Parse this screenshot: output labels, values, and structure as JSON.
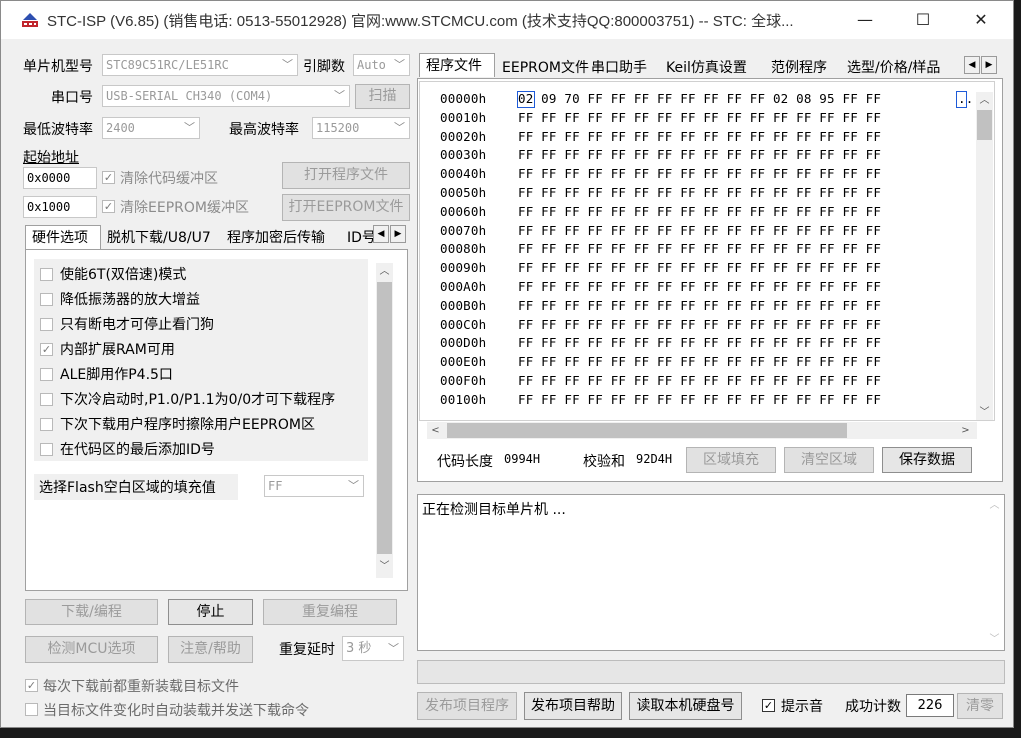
{
  "window": {
    "title": "STC-ISP (V6.85) (销售电话: 0513-55012928) 官网:www.STCMCU.com  (技术支持QQ:800003751)  -- STC: 全球...",
    "minimize": "—",
    "maximize": "☐",
    "close": "✕"
  },
  "left": {
    "mcu_type_label": "单片机型号",
    "mcu_type_value": "STC89C51RC/LE51RC",
    "pin_count_label": "引脚数",
    "pin_count_value": "Auto",
    "port_label": "串口号",
    "port_value": "USB-SERIAL CH340 (COM4)",
    "scan_button": "扫描",
    "min_baud_label": "最低波特率",
    "min_baud_value": "2400",
    "max_baud_label": "最高波特率",
    "max_baud_value": "115200",
    "start_addr_label": "起始地址",
    "code_addr": "0x0000",
    "clear_code_buffer": "清除代码缓冲区",
    "open_program_file": "打开程序文件",
    "eeprom_addr": "0x1000",
    "clear_eeprom_buffer": "清除EEPROM缓冲区",
    "open_eeprom_file": "打开EEPROM文件",
    "tabs": [
      "硬件选项",
      "脱机下载/U8/U7",
      "程序加密后传输",
      "ID号"
    ],
    "options": [
      {
        "label": "使能6T(双倍速)模式",
        "checked": false
      },
      {
        "label": "降低振荡器的放大增益",
        "checked": false
      },
      {
        "label": "只有断电才可停止看门狗",
        "checked": false
      },
      {
        "label": "内部扩展RAM可用",
        "checked": true
      },
      {
        "label": "ALE脚用作P4.5口",
        "checked": false
      },
      {
        "label": "下次冷启动时,P1.0/P1.1为0/0才可下载程序",
        "checked": false
      },
      {
        "label": "下次下载用户程序时擦除用户EEPROM区",
        "checked": false
      },
      {
        "label": "在代码区的最后添加ID号",
        "checked": false
      }
    ],
    "flash_fill_label": "选择Flash空白区域的填充值",
    "flash_fill_value": "FF",
    "download_button": "下载/编程",
    "stop_button": "停止",
    "reprogram_button": "重复编程",
    "detect_mcu_button": "检测MCU选项",
    "help_button": "注意/帮助",
    "repeat_delay_label": "重复延时",
    "repeat_delay_value": "3 秒",
    "reload_label": "每次下载前都重新装载目标文件",
    "reload_checked": true,
    "autoload_label": "当目标文件变化时自动装载并发送下载命令",
    "autoload_checked": false
  },
  "right": {
    "tabs": [
      "程序文件",
      "EEPROM文件",
      "串口助手",
      "Keil仿真设置",
      "范例程序",
      "选型/价格/样品"
    ],
    "hex": {
      "rows": [
        {
          "addr": "00000h",
          "bytes": "02 09 70 FF FF FF FF FF FF FF FF 02 08 95 FF FF",
          "ascii": ".."
        },
        {
          "addr": "00010h",
          "bytes": "FF FF FF FF FF FF FF FF FF FF FF FF FF FF FF FF"
        },
        {
          "addr": "00020h",
          "bytes": "FF FF FF FF FF FF FF FF FF FF FF FF FF FF FF FF"
        },
        {
          "addr": "00030h",
          "bytes": "FF FF FF FF FF FF FF FF FF FF FF FF FF FF FF FF"
        },
        {
          "addr": "00040h",
          "bytes": "FF FF FF FF FF FF FF FF FF FF FF FF FF FF FF FF"
        },
        {
          "addr": "00050h",
          "bytes": "FF FF FF FF FF FF FF FF FF FF FF FF FF FF FF FF"
        },
        {
          "addr": "00060h",
          "bytes": "FF FF FF FF FF FF FF FF FF FF FF FF FF FF FF FF"
        },
        {
          "addr": "00070h",
          "bytes": "FF FF FF FF FF FF FF FF FF FF FF FF FF FF FF FF"
        },
        {
          "addr": "00080h",
          "bytes": "FF FF FF FF FF FF FF FF FF FF FF FF FF FF FF FF"
        },
        {
          "addr": "00090h",
          "bytes": "FF FF FF FF FF FF FF FF FF FF FF FF FF FF FF FF"
        },
        {
          "addr": "000A0h",
          "bytes": "FF FF FF FF FF FF FF FF FF FF FF FF FF FF FF FF"
        },
        {
          "addr": "000B0h",
          "bytes": "FF FF FF FF FF FF FF FF FF FF FF FF FF FF FF FF"
        },
        {
          "addr": "000C0h",
          "bytes": "FF FF FF FF FF FF FF FF FF FF FF FF FF FF FF FF"
        },
        {
          "addr": "000D0h",
          "bytes": "FF FF FF FF FF FF FF FF FF FF FF FF FF FF FF FF"
        },
        {
          "addr": "000E0h",
          "bytes": "FF FF FF FF FF FF FF FF FF FF FF FF FF FF FF FF"
        },
        {
          "addr": "000F0h",
          "bytes": "FF FF FF FF FF FF FF FF FF FF FF FF FF FF FF FF"
        },
        {
          "addr": "00100h",
          "bytes": "FF FF FF FF FF FF FF FF FF FF FF FF FF FF FF FF"
        }
      ],
      "selected_byte": "02"
    },
    "code_length_label": "代码长度",
    "code_length_value": "0994H",
    "checksum_label": "校验和",
    "checksum_value": "92D4H",
    "fill_region_button": "区域填充",
    "clear_region_button": "清空区域",
    "save_data_button": "保存数据",
    "log_text": "正在检测目标单片机 ...",
    "publish_program_button": "发布项目程序",
    "publish_help_button": "发布项目帮助",
    "read_disk_id_button": "读取本机硬盘号",
    "beep_label": "提示音",
    "beep_checked": true,
    "success_count_label": "成功计数",
    "success_count_value": "226",
    "reset_count_button": "清零"
  },
  "colors": {
    "accent": "#1e5bd8",
    "disabled_text": "#9b9b9b",
    "window_bg": "#f0f0f0"
  }
}
